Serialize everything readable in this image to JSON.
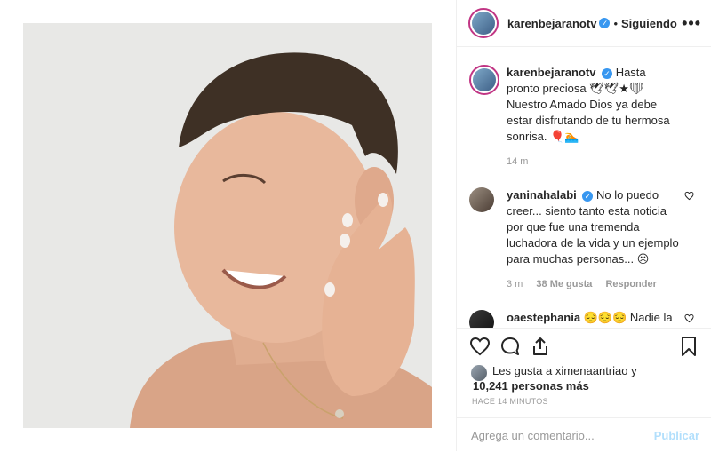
{
  "post": {
    "username": "karenbejaranotv",
    "follow_status": "Siguiendo",
    "dot": "•",
    "more": "•••",
    "caption_text": "Hasta pronto preciosa 🕊🕊★❤ Nuestro Amado Dios ya debe estar disfrutando de tu hermosa sonrisa. 🎈🏊",
    "caption_time": "14 m"
  },
  "comments": [
    {
      "username": "yaninahalabi",
      "text": "No lo puedo creer... siento tanto esta noticia por que fue una tremenda luchadora de la vida y un ejemplo para muchas personas... ☹",
      "time": "3 m",
      "likes": "38 Me gusta",
      "reply": "Responder"
    },
    {
      "username": "oaestephania",
      "text": "😔😔😔 Nadie la compara.... falta tanta gente como ella en esta tierra y se la llevan ☹"
    }
  ],
  "likes": {
    "line1": "Les gusta a ximenaantriao y",
    "line2": "10,241 personas más"
  },
  "timestamp": "HACE 14 MINUTOS",
  "add_comment": {
    "placeholder": "Agrega un comentario...",
    "publish": "Publicar"
  },
  "icons": [
    "heart-icon",
    "comment-icon",
    "share-icon",
    "bookmark-icon",
    "verified-icon",
    "more-icon"
  ],
  "colors": {
    "verified": "#3897f0",
    "story_ring": "#c13584",
    "publish": "#b2dffc"
  }
}
